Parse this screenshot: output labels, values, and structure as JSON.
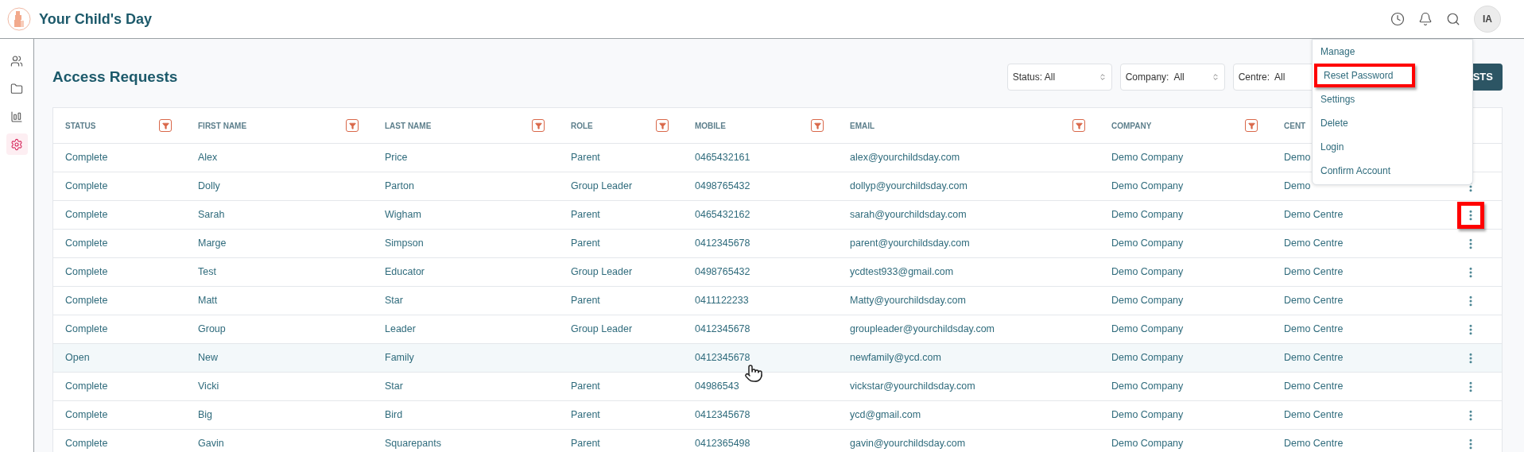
{
  "app": {
    "title": "Your Child's Day",
    "user_initials": "IA"
  },
  "sidebar": {
    "items": [
      {
        "kind": "users",
        "selected": false
      },
      {
        "kind": "folder",
        "selected": false
      },
      {
        "kind": "report",
        "selected": false
      },
      {
        "kind": "settings",
        "selected": true
      }
    ]
  },
  "page": {
    "title": "Access Requests"
  },
  "filters": [
    {
      "label": "Status: All"
    },
    {
      "label": "Company:  All"
    },
    {
      "label": "Centre:  All",
      "arrows": false
    }
  ],
  "action_button": {
    "label": "STS"
  },
  "table": {
    "columns": [
      {
        "label": "STATUS",
        "filter": true
      },
      {
        "label": "FIRST NAME",
        "filter": true
      },
      {
        "label": "LAST NAME",
        "filter": true
      },
      {
        "label": "ROLE",
        "filter": true
      },
      {
        "label": "MOBILE",
        "filter": true
      },
      {
        "label": "EMAIL",
        "filter": true
      },
      {
        "label": "COMPANY",
        "filter": true
      },
      {
        "label": "CENT",
        "filter": false
      }
    ],
    "rows": [
      {
        "cells": [
          "Complete",
          "Alex",
          "Price",
          "Parent",
          "0465432161",
          "alex@yourchildsday.com",
          "Demo Company",
          "Demo"
        ],
        "hovered": false,
        "menu_button": false
      },
      {
        "cells": [
          "Complete",
          "Dolly",
          "Parton",
          "Group Leader",
          "0498765432",
          "dollyp@yourchildsday.com",
          "Demo Company",
          "Demo"
        ],
        "hovered": false
      },
      {
        "cells": [
          "Complete",
          "Sarah",
          "Wigham",
          "Parent",
          "0465432162",
          "sarah@yourchildsday.com",
          "Demo Company",
          "Demo Centre"
        ],
        "hovered": false,
        "callout": true
      },
      {
        "cells": [
          "Complete",
          "Marge",
          "Simpson",
          "Parent",
          "0412345678",
          "parent@yourchildsday.com",
          "Demo Company",
          "Demo Centre"
        ],
        "hovered": false
      },
      {
        "cells": [
          "Complete",
          "Test",
          "Educator",
          "Group Leader",
          "0498765432",
          "ycdtest933@gmail.com",
          "Demo Company",
          "Demo Centre"
        ],
        "hovered": false
      },
      {
        "cells": [
          "Complete",
          "Matt",
          "Star",
          "Parent",
          "0411122233",
          "Matty@yourchildsday.com",
          "Demo Company",
          "Demo Centre"
        ],
        "hovered": false
      },
      {
        "cells": [
          "Complete",
          "Group",
          "Leader",
          "Group Leader",
          "0412345678",
          "groupleader@yourchildsday.com",
          "Demo Company",
          "Demo Centre"
        ],
        "hovered": false
      },
      {
        "cells": [
          "Open",
          "New",
          "Family",
          "",
          "0412345678",
          "newfamily@ycd.com",
          "Demo Company",
          "Demo Centre"
        ],
        "hovered": true
      },
      {
        "cells": [
          "Complete",
          "Vicki",
          "Star",
          "Parent",
          "04986543",
          "vickstar@yourchildsday.com",
          "Demo Company",
          "Demo Centre"
        ],
        "hovered": false
      },
      {
        "cells": [
          "Complete",
          "Big",
          "Bird",
          "Parent",
          "0412345678",
          "ycd@gmail.com",
          "Demo Company",
          "Demo Centre"
        ],
        "hovered": false
      },
      {
        "cells": [
          "Complete",
          "Gavin",
          "Squarepants",
          "Parent",
          "0412365498",
          "gavin@yourchildsday.com",
          "Demo Company",
          "Demo Centre"
        ],
        "hovered": false
      }
    ]
  },
  "row_menu": {
    "items": [
      {
        "label": "Manage",
        "callout": false
      },
      {
        "label": "Reset Password",
        "callout": true
      },
      {
        "label": "Settings",
        "callout": false
      },
      {
        "label": "Delete",
        "callout": false
      },
      {
        "label": "Login",
        "callout": false
      },
      {
        "label": "Confirm Account",
        "callout": false
      }
    ]
  }
}
